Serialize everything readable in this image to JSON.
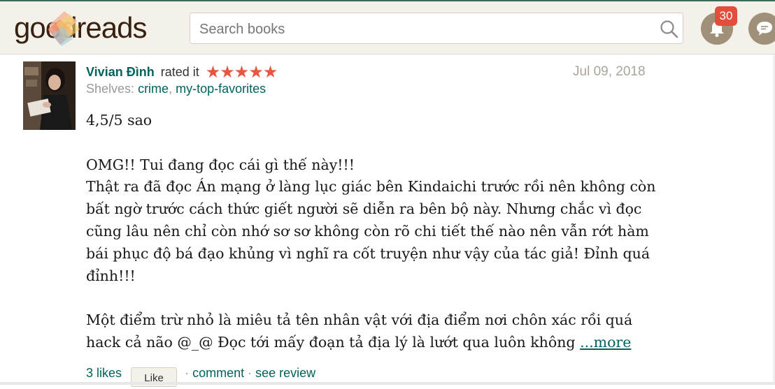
{
  "header": {
    "logo_text": "goodreads",
    "search_placeholder": "Search books",
    "notifications_count": "30",
    "colors": {
      "bar": "#f4f1ea",
      "brand": "#382110",
      "accent": "#00635d",
      "badge": "#e24e3c"
    }
  },
  "review": {
    "author": "Vivian Đình",
    "rated_text": "rated it",
    "stars": "★★★★★",
    "rating": 5,
    "date": "Jul 09, 2018",
    "shelves_label": "Shelves:",
    "shelves": [
      "crime",
      "my-top-favorites"
    ],
    "shelf_separator": ",",
    "paragraphs": [
      "4,5/5 sao",
      "OMG!! Tui đang đọc cái gì thế này!!!",
      "Thật ra đã đọc Án mạng ở làng lục giác bên Kindaichi trước rồi nên không còn bất ngờ trước cách thức giết người sẽ diễn ra bên bộ này. Nhưng chắc vì đọc cũng lâu nên chỉ còn nhớ sơ sơ không còn rõ chi tiết thế nào nên vẫn rớt hàm bái phục độ bá đạo khủng vì nghĩ ra cốt truyện như vậy của tác giả! Đỉnh quá đỉnh!!!",
      "Một điểm trừ nhỏ là miêu tả tên nhân vật với địa điểm nơi chôn xác rồi quá hack cả não @_@ Đọc tới mấy đoạn tả địa lý là lướt qua luôn không"
    ],
    "more_label": "...more",
    "likes": "3 likes",
    "like_button": "Like",
    "comment_label": "comment",
    "see_review_label": "see review",
    "dot": "·"
  }
}
